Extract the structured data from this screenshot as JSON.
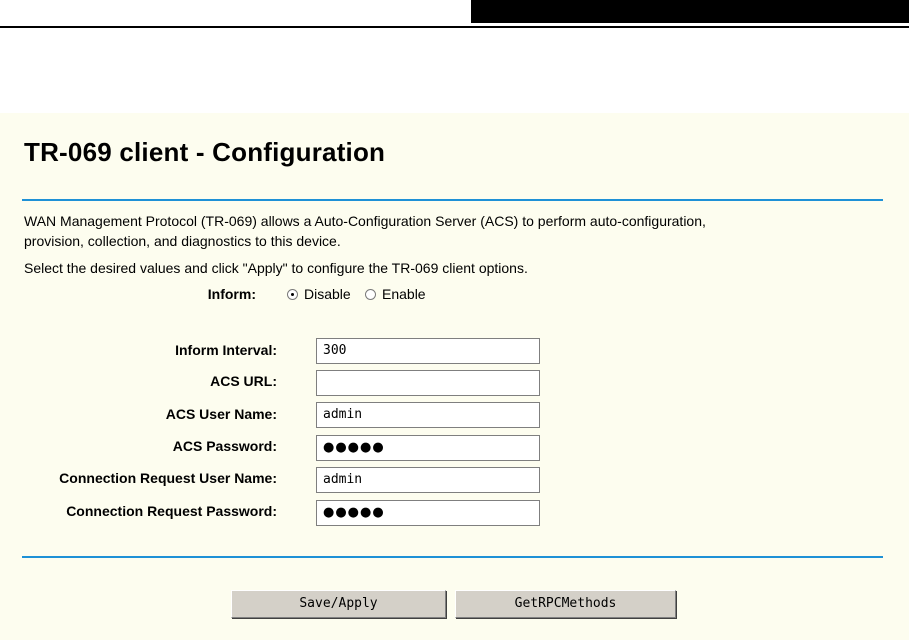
{
  "title": "TR-069 client - Configuration",
  "description": {
    "line1": "WAN Management Protocol (TR-069) allows a Auto-Configuration Server (ACS) to perform auto-configuration,",
    "line2": "provision, collection, and diagnostics to this device.",
    "line3": "Select the desired values and click \"Apply\" to configure the TR-069 client options."
  },
  "inform": {
    "label": "Inform:",
    "options": [
      {
        "label": "Disable",
        "selected": true
      },
      {
        "label": "Enable",
        "selected": false
      }
    ]
  },
  "fields": [
    {
      "label": "Inform Interval:",
      "value": "300"
    },
    {
      "label": "ACS URL:",
      "value": ""
    },
    {
      "label": "ACS User Name:",
      "value": "admin"
    },
    {
      "label": "ACS Password:",
      "value": "●●●●●"
    },
    {
      "label": "Connection Request User Name:",
      "value": "admin"
    },
    {
      "label": "Connection Request Password:",
      "value": "●●●●●"
    }
  ],
  "buttons": {
    "save": "Save/Apply",
    "rpc": "GetRPCMethods"
  },
  "colors": {
    "panel_background": "#fdfdef",
    "rule_blue": "#1e91d6",
    "button_face": "#d4d0c8"
  }
}
